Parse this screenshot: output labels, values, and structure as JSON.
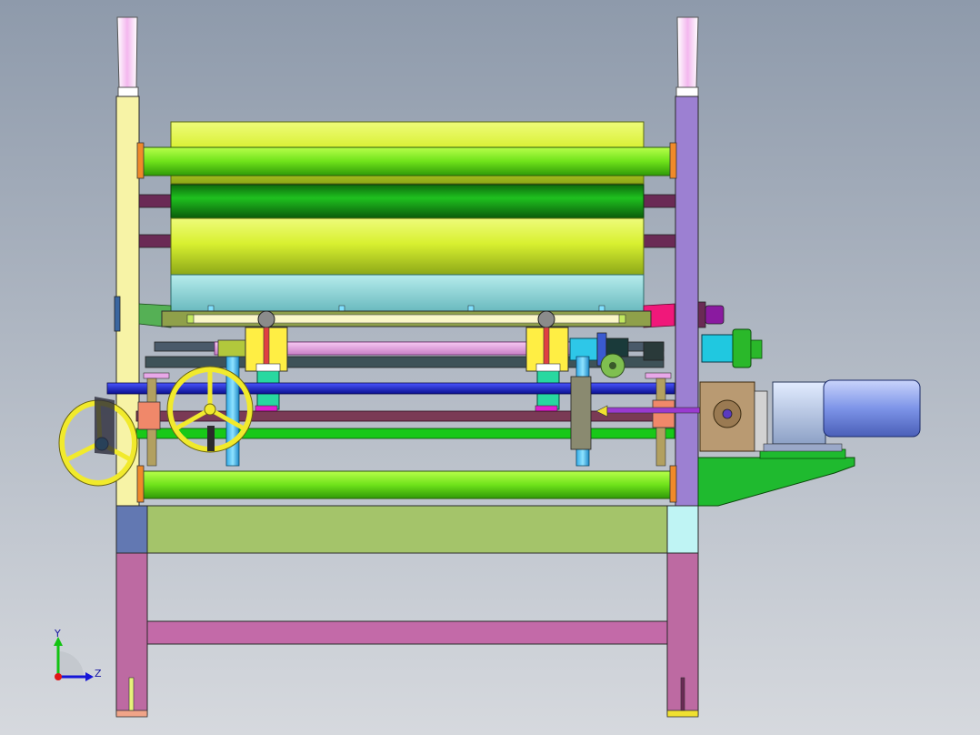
{
  "viewport": {
    "background_top": "#8e9aab",
    "background_bottom": "#d6d9de"
  },
  "triad": {
    "y_label": "Y",
    "z_label": "Z",
    "y_color": "#12c312",
    "z_color": "#1515d8",
    "origin_color": "#e01616"
  },
  "colors": {
    "left_column": "#f7f3a6",
    "right_column": "#9c80d2",
    "leg": "#bd6aa2",
    "base_beam": "#a4c46a",
    "roller_lime": "#d8f030",
    "roller_green": "#17a317",
    "roller_cyan": "#8ed6d8",
    "shaft_blue": "#0d18c8",
    "handwheel": "#f1ea2c",
    "motor": "#7d94e8",
    "gearbox": "#b99a72",
    "motor_mount": "#1fba2f"
  }
}
